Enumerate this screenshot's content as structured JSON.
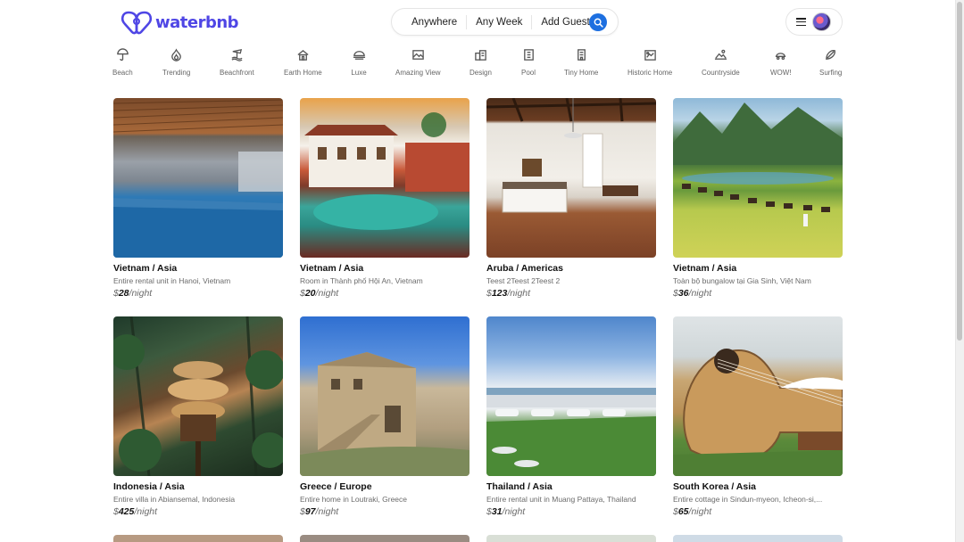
{
  "brand": {
    "name": "waterbnb",
    "color": "#4f46e5"
  },
  "search": {
    "where": "Anywhere",
    "when": "Any Week",
    "who": "Add Guests",
    "button_icon": "search-icon",
    "button_color": "#1d6fe0"
  },
  "user_menu": {
    "menu_icon": "hamburger-icon",
    "avatar": "avatar"
  },
  "categories": [
    {
      "label": "Beach",
      "icon": "umbrella-icon"
    },
    {
      "label": "Trending",
      "icon": "fire-icon"
    },
    {
      "label": "Beachfront",
      "icon": "beachfront-icon"
    },
    {
      "label": "Earth Home",
      "icon": "earth-home-icon"
    },
    {
      "label": "Luxe",
      "icon": "luxe-icon"
    },
    {
      "label": "Amazing View",
      "icon": "view-icon"
    },
    {
      "label": "Design",
      "icon": "design-icon"
    },
    {
      "label": "Pool",
      "icon": "pool-icon"
    },
    {
      "label": "Tiny Home",
      "icon": "tiny-home-icon"
    },
    {
      "label": "Historic Home",
      "icon": "historic-home-icon"
    },
    {
      "label": "Countryside",
      "icon": "countryside-icon"
    },
    {
      "label": "WOW!",
      "icon": "wow-icon"
    },
    {
      "label": "Surfing",
      "icon": "surfboard-icon"
    }
  ],
  "listings": [
    {
      "location": "Vietnam / Asia",
      "description": "Entire rental unit in Hanoi, Vietnam",
      "currency": "$",
      "price": "28",
      "per": "/night"
    },
    {
      "location": "Vietnam / Asia",
      "description": "Room in Thành phố Hội An, Vietnam",
      "currency": "$",
      "price": "20",
      "per": "/night"
    },
    {
      "location": "Aruba / Americas",
      "description": "Teest 2Teest 2Teest 2",
      "currency": "$",
      "price": "123",
      "per": "/night"
    },
    {
      "location": "Vietnam / Asia",
      "description": "Toàn bộ bungalow tại Gia Sinh, Việt Nam",
      "currency": "$",
      "price": "36",
      "per": "/night"
    },
    {
      "location": "Indonesia / Asia",
      "description": "Entire villa in Abiansemal, Indonesia",
      "currency": "$",
      "price": "425",
      "per": "/night"
    },
    {
      "location": "Greece / Europe",
      "description": "Entire home in Loutraki, Greece",
      "currency": "$",
      "price": "97",
      "per": "/night"
    },
    {
      "location": "Thailand / Asia",
      "description": "Entire rental unit in Muang Pattaya, Thailand",
      "currency": "$",
      "price": "31",
      "per": "/night"
    },
    {
      "location": "South Korea / Asia",
      "description": "Entire cottage in Sindun-myeon, Icheon-si,...",
      "currency": "$",
      "price": "65",
      "per": "/night"
    }
  ]
}
